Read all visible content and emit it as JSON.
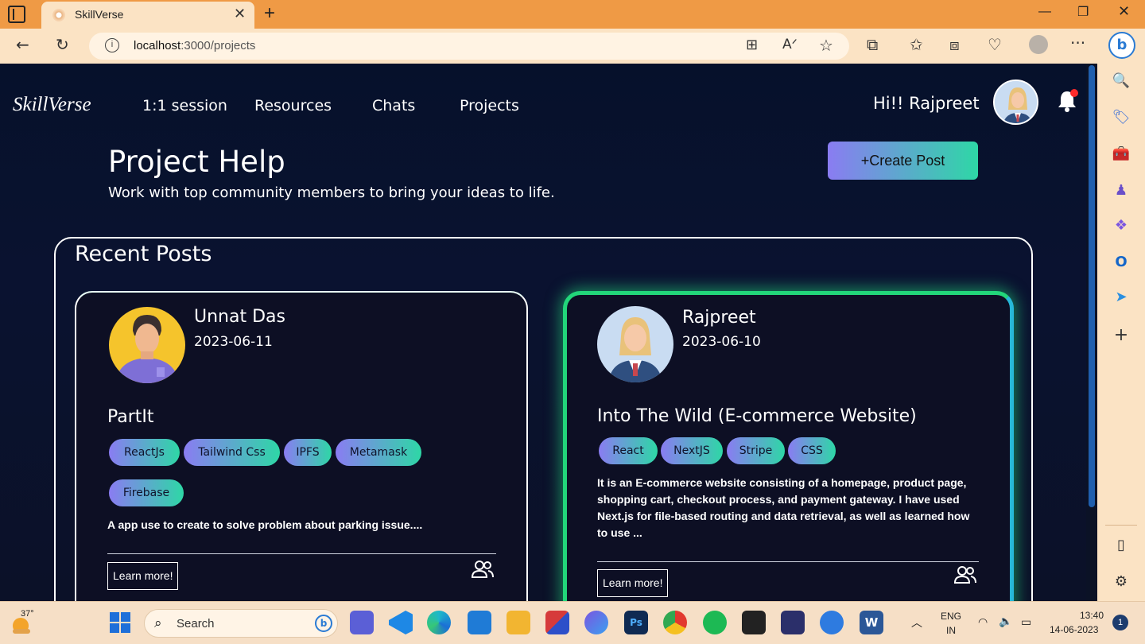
{
  "browser": {
    "tab_title": "SkillVerse",
    "address_host": "localhost",
    "address_path": ":3000/projects"
  },
  "nav": {
    "brand": "SkillVerse",
    "links": [
      "1:1 session",
      "Resources",
      "Chats",
      "Projects"
    ],
    "greeting": "Hi!! Rajpreet"
  },
  "header": {
    "title": "Project Help",
    "subtitle": "Work with top community members to bring your ideas to life.",
    "create_button": "+Create Post"
  },
  "recent": {
    "title": "Recent Posts",
    "posts": [
      {
        "author": "Unnat Das",
        "date": "2023-06-11",
        "title": "PartIt",
        "tags": [
          "ReactJs",
          "Tailwind Css",
          "IPFS",
          "Metamask",
          "Firebase"
        ],
        "description": "A app use to create to solve problem about parking issue....",
        "button": "Learn more!"
      },
      {
        "author": "Rajpreet",
        "date": "2023-06-10",
        "title": "Into The Wild (E-commerce Website)",
        "tags": [
          "React",
          "NextJS",
          "Stripe",
          "CSS"
        ],
        "description": "It is an E-commerce website consisting of a homepage, product page, shopping cart, checkout process, and payment gateway. I have used Next.js for file-based routing and data retrieval, as well as learned how to use ...",
        "button": "Learn more!"
      }
    ]
  },
  "taskbar": {
    "temperature": "37°",
    "search_placeholder": "Search",
    "lang_top": "ENG",
    "lang_bottom": "IN",
    "time": "13:40",
    "date": "14-06-2023",
    "notification_count": "1"
  },
  "colors": {
    "accent_gradient_start": "#8a7cf2",
    "accent_gradient_end": "#2ed7a6",
    "highlight_border": "#22d67a",
    "page_background": "#0b1226",
    "browser_chrome": "#ef9a45"
  }
}
